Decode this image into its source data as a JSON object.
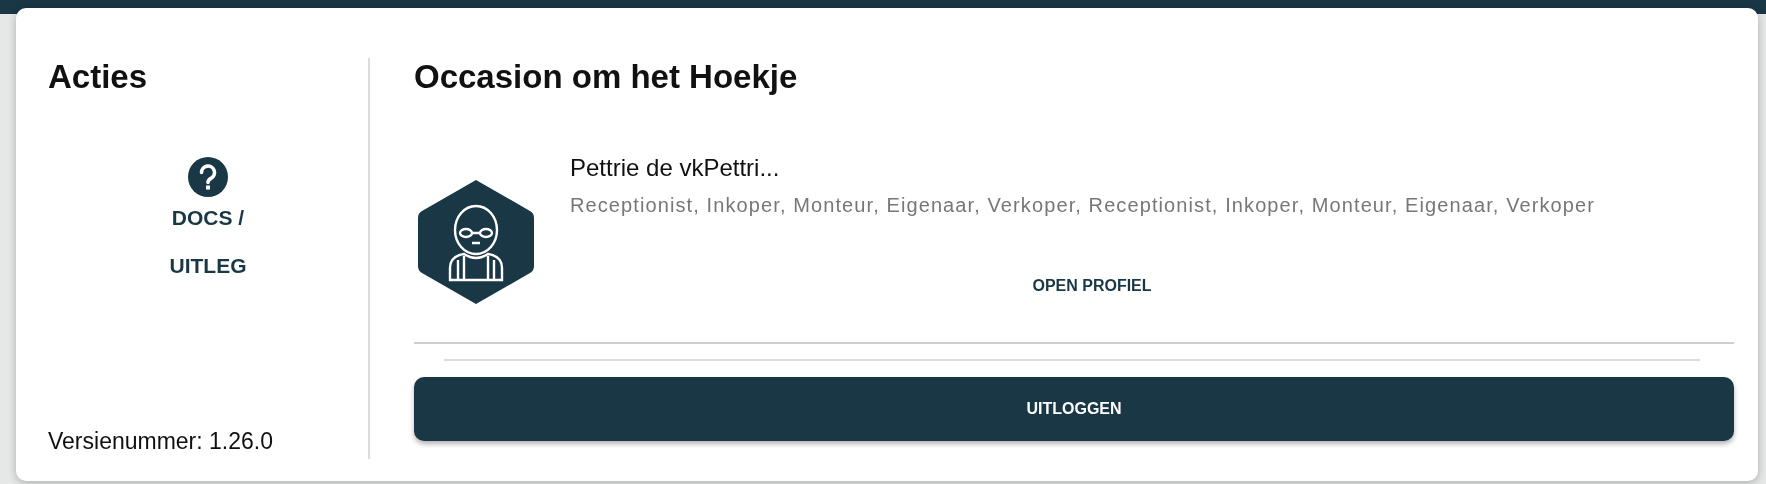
{
  "sidebar": {
    "title": "Acties",
    "docs_link": {
      "line_1": "DOCS /",
      "line_2": "UITLEG"
    },
    "version": "Versienummer: 1.26.0"
  },
  "main": {
    "title": "Occasion om het Hoekje",
    "profile": {
      "name": "Pettrie de vkPettri...",
      "roles": "Receptionist, Inkoper, Monteur, Eigenaar, Verkoper, Receptionist, Inkoper, Monteur, Eigenaar, Verkoper",
      "open_button": "OPEN PROFIEL"
    },
    "logout_button": "UITLOGGEN"
  }
}
